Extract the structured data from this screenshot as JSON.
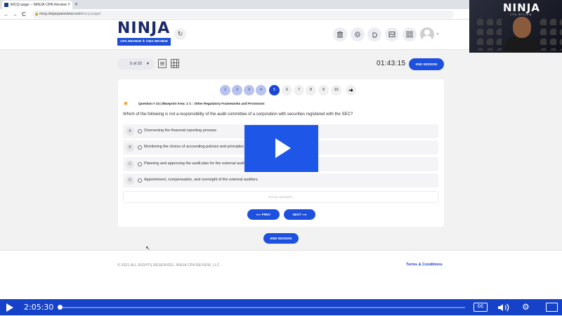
{
  "browser": {
    "tab_title": "MCQ page – NINJA CPA Review",
    "tab_close": "×",
    "new_tab": "+",
    "back": "←",
    "forward": "→",
    "reload": "C",
    "url_domain": "mcq.ninjacpareview.com",
    "url_path": "/mcq-page/"
  },
  "header": {
    "logo_word": "NINJA",
    "logo_strip": "CPA REVIEW ✈ CMA REVIEW",
    "refresh_icon": "↻",
    "icons": [
      "bank-icon",
      "brightness-icon",
      "hand-icon",
      "map-icon",
      "grid-icon"
    ],
    "avatar_chevron": "⌄"
  },
  "webcam": {
    "brand": "NINJA",
    "tagline": "CPA REVIEW"
  },
  "toolbar": {
    "page_selector": "5 of 20",
    "timer": "01:43:15",
    "end_session": "END SESSION"
  },
  "question_nav": {
    "items": [
      "1",
      "2",
      "3",
      "4",
      "5",
      "6",
      "7",
      "8",
      "9",
      "10"
    ],
    "current": 5,
    "arrow": "➜"
  },
  "question": {
    "star": "★",
    "meta": "Question # 24 | Blueprint Area: 1 C : Other Regulatory Frameworks and Provisions",
    "text": "Which of the following is not a responsibility of the audit committee of a corporation with securities registered with the SEC?",
    "options": [
      {
        "letter": "A",
        "text": "Overseeing the financial reporting process"
      },
      {
        "letter": "B",
        "text": "Monitoring the choice of accounting policies and principles"
      },
      {
        "letter": "C",
        "text": "Planning and approving the audit plan for the external auditors"
      },
      {
        "letter": "D",
        "text": "Appointment, compensation, and oversight of the external auditors"
      }
    ],
    "show_answer": "SHOW ANSWER",
    "prev": "⟵  PREV",
    "next": "NEXT  ⟶",
    "end_session": "END SESSION"
  },
  "footer": {
    "copyright": "© 2021 ALL RIGHTS RESERVED. NINJA CPA REVIEW, LLC.",
    "terms": "Terms & Conditions"
  },
  "player": {
    "time": "2:05:30",
    "progress": 0.0,
    "cc": "CC",
    "volume_icon": "🔊",
    "settings_icon": "⚙",
    "cursor": "↖"
  },
  "colors": {
    "brand_blue": "#1e50e0",
    "nav_done": "#b8c3ef",
    "star": "#f29111",
    "player_bar": "#1542c9"
  }
}
